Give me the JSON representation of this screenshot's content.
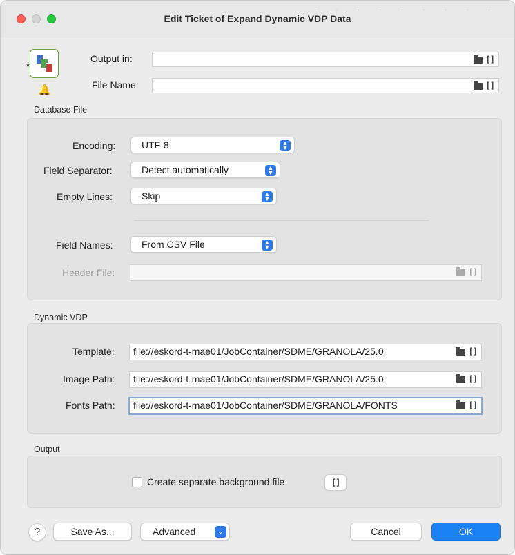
{
  "window": {
    "title": "Edit Ticket of Expand Dynamic VDP Data"
  },
  "top": {
    "output_in": {
      "label": "Output in:",
      "value": ""
    },
    "file_name": {
      "label": "File Name:",
      "value": ""
    }
  },
  "database_file": {
    "section": "Database File",
    "encoding": {
      "label": "Encoding:",
      "value": "UTF-8"
    },
    "field_separator": {
      "label": "Field Separator:",
      "value": "Detect automatically"
    },
    "empty_lines": {
      "label": "Empty Lines:",
      "value": "Skip"
    },
    "field_names": {
      "label": "Field Names:",
      "value": "From CSV File"
    },
    "header_file": {
      "label": "Header File:",
      "value": ""
    }
  },
  "dynamic_vdp": {
    "section": "Dynamic VDP",
    "template": {
      "label": "Template:",
      "value": "file://eskord-t-mae01/JobContainer/SDME/GRANOLA/25.0"
    },
    "image_path": {
      "label": "Image Path:",
      "value": "file://eskord-t-mae01/JobContainer/SDME/GRANOLA/25.0"
    },
    "fonts_path": {
      "label": "Fonts Path:",
      "value": "file://eskord-t-mae01/JobContainer/SDME/GRANOLA/FONTS"
    }
  },
  "output": {
    "section": "Output",
    "checkbox_label": "Create separate background file",
    "checked": false
  },
  "footer": {
    "help": "?",
    "save_as": "Save As...",
    "advanced": "Advanced",
    "cancel": "Cancel",
    "ok": "OK"
  },
  "icons": {
    "folder": "folder-icon",
    "variable": "brackets-icon",
    "bell": "bell-icon",
    "chevron": "updown-chevron-icon"
  },
  "colors": {
    "accent": "#2f7ae5",
    "primary_button": "#1a82f5"
  }
}
